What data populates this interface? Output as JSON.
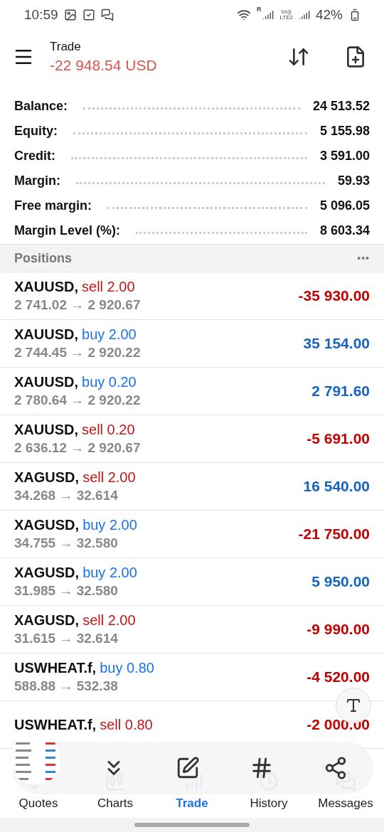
{
  "status_bar": {
    "time": "10:59",
    "roaming": "R",
    "volte_top": "Vo))",
    "volte_bottom": "LTE2",
    "battery": "42%"
  },
  "header": {
    "title": "Trade",
    "balance": "-22 948.54 USD"
  },
  "summary": [
    {
      "label": "Balance:",
      "value": "24 513.52"
    },
    {
      "label": "Equity:",
      "value": "5 155.98"
    },
    {
      "label": "Credit:",
      "value": "3 591.00"
    },
    {
      "label": "Margin:",
      "value": "59.93"
    },
    {
      "label": "Free margin:",
      "value": "5 096.05"
    },
    {
      "label": "Margin Level (%):",
      "value": "8 603.34"
    }
  ],
  "positions_header": {
    "title": "Positions",
    "more": "•••"
  },
  "positions": [
    {
      "symbol": "XAUUSD,",
      "order": {
        "text": "sell 2.00",
        "color": "#c51616"
      },
      "prices": "2 741.02 → 2 920.67",
      "profit": {
        "text": "-35 930.00",
        "color": "#c40000"
      }
    },
    {
      "symbol": "XAUUSD,",
      "order": {
        "text": "buy 2.00",
        "color": "#1a73e8"
      },
      "prices": "2 744.45 → 2 920.22",
      "profit": {
        "text": "35 154.00",
        "color": "#1565c0"
      }
    },
    {
      "symbol": "XAUUSD,",
      "order": {
        "text": "buy 0.20",
        "color": "#1a73e8"
      },
      "prices": "2 780.64 → 2 920.22",
      "profit": {
        "text": "2 791.60",
        "color": "#1565c0"
      }
    },
    {
      "symbol": "XAUUSD,",
      "order": {
        "text": "sell 0.20",
        "color": "#c51616"
      },
      "prices": "2 636.12 → 2 920.67",
      "profit": {
        "text": "-5 691.00",
        "color": "#c40000"
      }
    },
    {
      "symbol": "XAGUSD,",
      "order": {
        "text": "sell 2.00",
        "color": "#c51616"
      },
      "prices": "34.268 → 32.614",
      "profit": {
        "text": "16 540.00",
        "color": "#1565c0"
      }
    },
    {
      "symbol": "XAGUSD,",
      "order": {
        "text": "buy 2.00",
        "color": "#1a73e8"
      },
      "prices": "34.755 → 32.580",
      "profit": {
        "text": "-21 750.00",
        "color": "#c40000"
      }
    },
    {
      "symbol": "XAGUSD,",
      "order": {
        "text": "buy 2.00",
        "color": "#1a73e8"
      },
      "prices": "31.985 → 32.580",
      "profit": {
        "text": "5 950.00",
        "color": "#1565c0"
      }
    },
    {
      "symbol": "XAGUSD,",
      "order": {
        "text": "sell 2.00",
        "color": "#c51616"
      },
      "prices": "31.615 → 32.614",
      "profit": {
        "text": "-9 990.00",
        "color": "#c40000"
      }
    },
    {
      "symbol": "USWHEAT.f,",
      "order": {
        "text": "buy 0.80",
        "color": "#1a73e8"
      },
      "prices": "588.88 → 532.38",
      "profit": {
        "text": "-4 520.00",
        "color": "#c40000"
      }
    },
    {
      "symbol": "USWHEAT.f,",
      "order": {
        "text": "sell 0.80",
        "color": "#c51616"
      },
      "profit": {
        "text": "-2 000.00",
        "color": "#c40000"
      }
    }
  ],
  "screenshot_toolbar": {
    "tools": [
      {
        "kind": "scroll"
      },
      {
        "kind": "edit"
      },
      {
        "kind": "tag"
      },
      {
        "kind": "share"
      }
    ]
  },
  "nav": [
    {
      "label": "Quotes",
      "kind": "quotes",
      "selected": false
    },
    {
      "label": "Charts",
      "kind": "charts",
      "selected": false
    },
    {
      "label": "Trade",
      "kind": "trade",
      "selected": true
    },
    {
      "label": "History",
      "kind": "history",
      "selected": false
    },
    {
      "label": "Messages",
      "kind": "messages",
      "selected": false
    }
  ]
}
